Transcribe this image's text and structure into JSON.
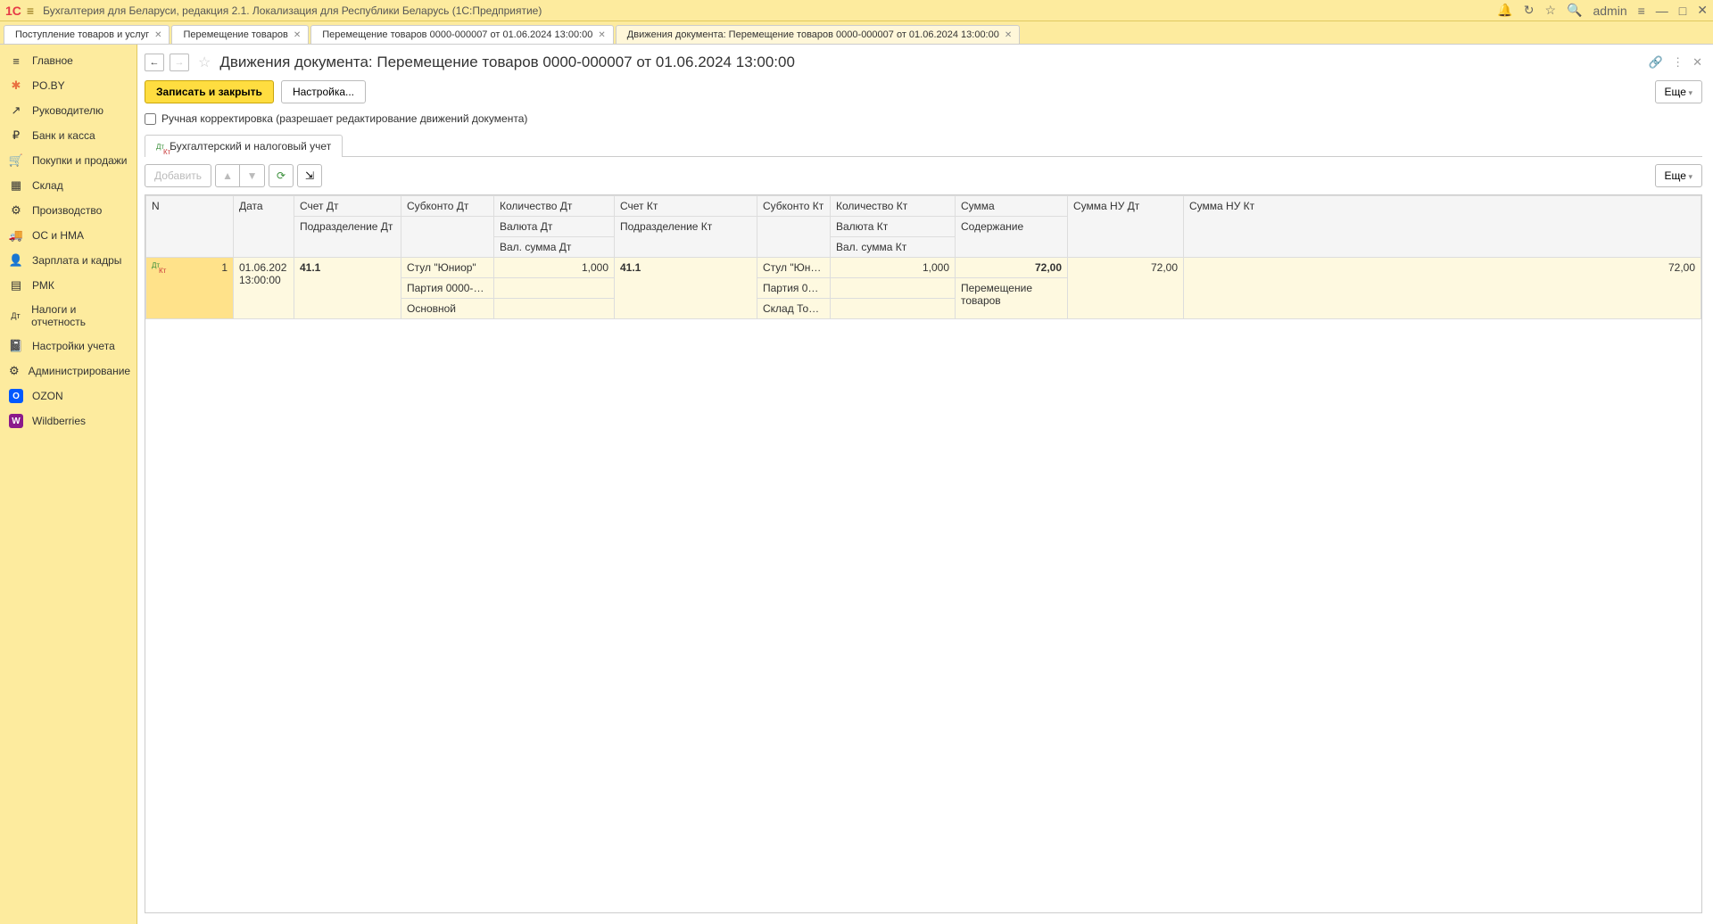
{
  "app": {
    "title": "Бухгалтерия для Беларуси, редакция 2.1. Локализация для Республики Беларусь  (1С:Предприятие)",
    "user": "admin"
  },
  "tabs": [
    {
      "label": "Поступление товаров и услуг"
    },
    {
      "label": "Перемещение товаров"
    },
    {
      "label": "Перемещение товаров 0000-000007 от 01.06.2024 13:00:00"
    },
    {
      "label": "Движения документа: Перемещение товаров 0000-000007 от 01.06.2024 13:00:00"
    }
  ],
  "sidebar": {
    "items": [
      {
        "icon": "≡",
        "label": "Главное"
      },
      {
        "icon": "✱",
        "label": "PO.BY",
        "color": "#e97040"
      },
      {
        "icon": "↗",
        "label": "Руководителю"
      },
      {
        "icon": "₽",
        "label": "Банк и касса"
      },
      {
        "icon": "🛒",
        "label": "Покупки и продажи"
      },
      {
        "icon": "▦",
        "label": "Склад"
      },
      {
        "icon": "⚙",
        "label": "Производство"
      },
      {
        "icon": "🚚",
        "label": "ОС и НМА"
      },
      {
        "icon": "👤",
        "label": "Зарплата и кадры"
      },
      {
        "icon": "▤",
        "label": "РМК"
      },
      {
        "icon": "Дт",
        "label": "Налоги и отчетность"
      },
      {
        "icon": "📓",
        "label": "Настройки учета"
      },
      {
        "icon": "⚙",
        "label": "Администрирование"
      },
      {
        "icon": "О",
        "label": "OZON",
        "bg": "#0059ff",
        "fg": "#fff"
      },
      {
        "icon": "W",
        "label": "Wildberries",
        "bg": "#8b1a8b",
        "fg": "#fff"
      }
    ]
  },
  "page": {
    "title": "Движения документа: Перемещение товаров 0000-000007 от 01.06.2024 13:00:00",
    "save_close": "Записать и закрыть",
    "settings": "Настройка...",
    "more": "Еще",
    "manual_edit_label": "Ручная корректировка (разрешает редактирование движений документа)",
    "inner_tab": "Бухгалтерский и налоговый учет",
    "add_btn": "Добавить"
  },
  "table": {
    "headers": {
      "n": "N",
      "date": "Дата",
      "acc_dt": "Счет Дт",
      "div_dt": "Подразделение Дт",
      "sub_dt": "Субконто Дт",
      "qty_dt": "Количество Дт",
      "cur_dt": "Валюта Дт",
      "cursum_dt": "Вал. сумма Дт",
      "acc_kt": "Счет Кт",
      "div_kt": "Подразделение Кт",
      "sub_kt": "Субконто Кт",
      "qty_kt": "Количество Кт",
      "cur_kt": "Валюта Кт",
      "cursum_kt": "Вал. сумма Кт",
      "sum": "Сумма",
      "desc": "Содержание",
      "nu_dt": "Сумма НУ Дт",
      "nu_kt": "Сумма НУ Кт"
    },
    "rows": [
      {
        "n": "1",
        "date": "01.06.202",
        "time": "13:00:00",
        "acc_dt": "41.1",
        "sub_dt_1": "Стул \"Юниор\"",
        "sub_dt_2": "Партия 0000-0…",
        "sub_dt_3": "Основной",
        "qty_dt": "1,000",
        "acc_kt": "41.1",
        "sub_kt_1": "Стул \"Юни…",
        "sub_kt_2": "Партия 00…",
        "sub_kt_3": "Склад Тов…",
        "qty_kt": "1,000",
        "sum": "72,00",
        "desc": "Перемещение товаров",
        "nu_dt": "72,00",
        "nu_kt": "72,00"
      }
    ]
  }
}
